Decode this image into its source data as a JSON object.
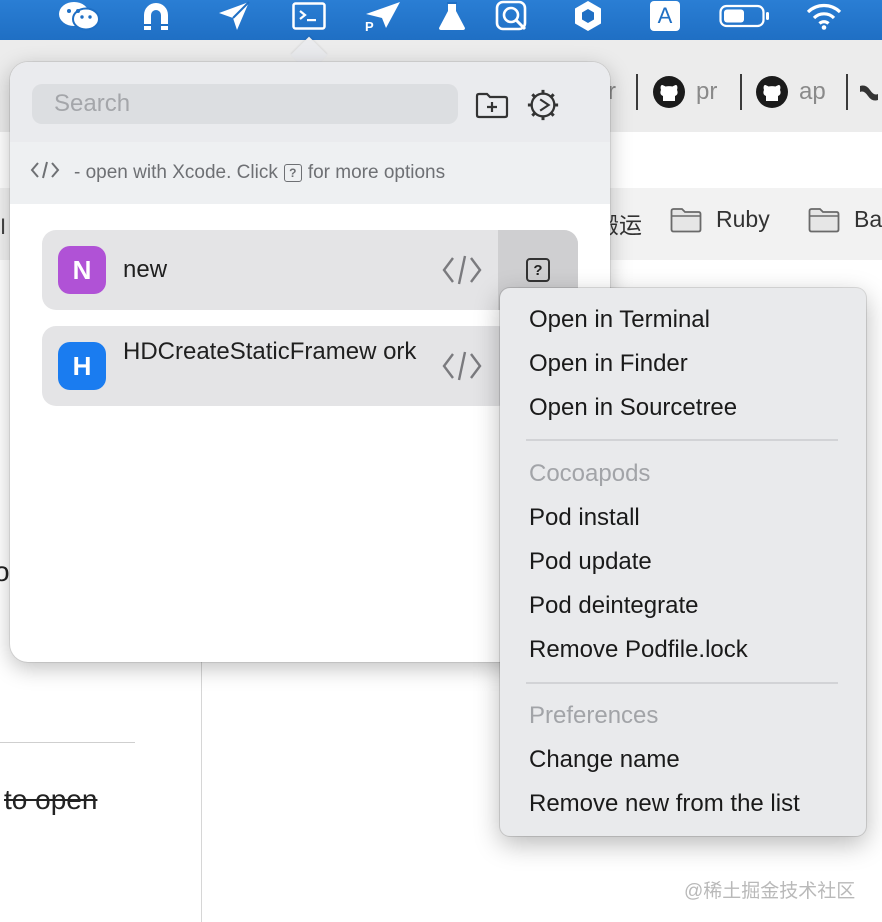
{
  "menubar": {
    "icons": [
      "wechat-icon",
      "magnet-icon",
      "send-icon",
      "terminal-icon",
      "paper-plane-icon",
      "flask-icon",
      "magnifier-icon",
      "hexagon-icon",
      "input-source-icon",
      "battery-icon",
      "wifi-icon"
    ],
    "input_source_label": "A",
    "paperplane_label": "P",
    "accent": "#1f6fc4"
  },
  "browser": {
    "tabs": [
      {
        "label": "r"
      },
      {
        "label": "pr"
      },
      {
        "label": "ap"
      }
    ],
    "bookmarks": [
      {
        "label": "搬运"
      },
      {
        "label": "Ruby"
      },
      {
        "label": "Ba"
      }
    ],
    "left_fragment": "o",
    "strike_text": "to open",
    "left_mark": "I",
    "watermark": "@稀土掘金技术社区"
  },
  "popover": {
    "search_placeholder": "Search",
    "hint_prefix": "- open with Xcode. Click",
    "hint_q": "?",
    "hint_suffix": "for more options",
    "projects": [
      {
        "initial": "N",
        "name": "new",
        "color": "#b052d6"
      },
      {
        "initial": "H",
        "name": "HDCreateStaticFramew ork",
        "color": "#1a7cf0"
      }
    ],
    "help_label": "?"
  },
  "context_menu": {
    "open_items": [
      "Open in Terminal",
      "Open in Finder",
      "Open in Sourcetree"
    ],
    "cocoapods_header": "Cocoapods",
    "cocoapods_items": [
      "Pod install",
      "Pod update",
      "Pod deintegrate",
      "Remove Podfile.lock"
    ],
    "preferences_header": "Preferences",
    "preferences_items": [
      "Change name",
      "Remove new from the list"
    ]
  }
}
